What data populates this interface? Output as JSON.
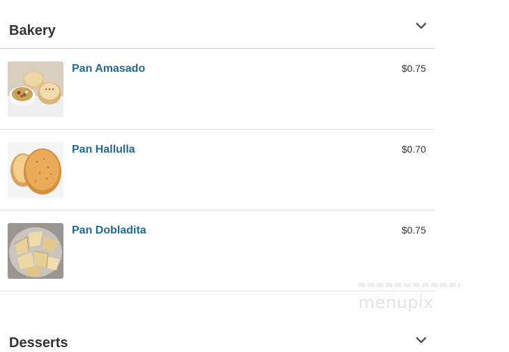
{
  "sections": [
    {
      "title": "Bakery",
      "items": [
        {
          "name": "Pan Amasado",
          "price": "$0.75"
        },
        {
          "name": "Pan Hallulla",
          "price": "$0.70"
        },
        {
          "name": "Pan Dobladita",
          "price": "$0.75"
        }
      ]
    },
    {
      "title": "Desserts",
      "items": []
    }
  ],
  "watermark": "menupix",
  "colors": {
    "item_name": "#1f6b96",
    "heading": "#333333",
    "divider": "#cfcfcf"
  },
  "icons": [
    "chevron-down-icon"
  ]
}
